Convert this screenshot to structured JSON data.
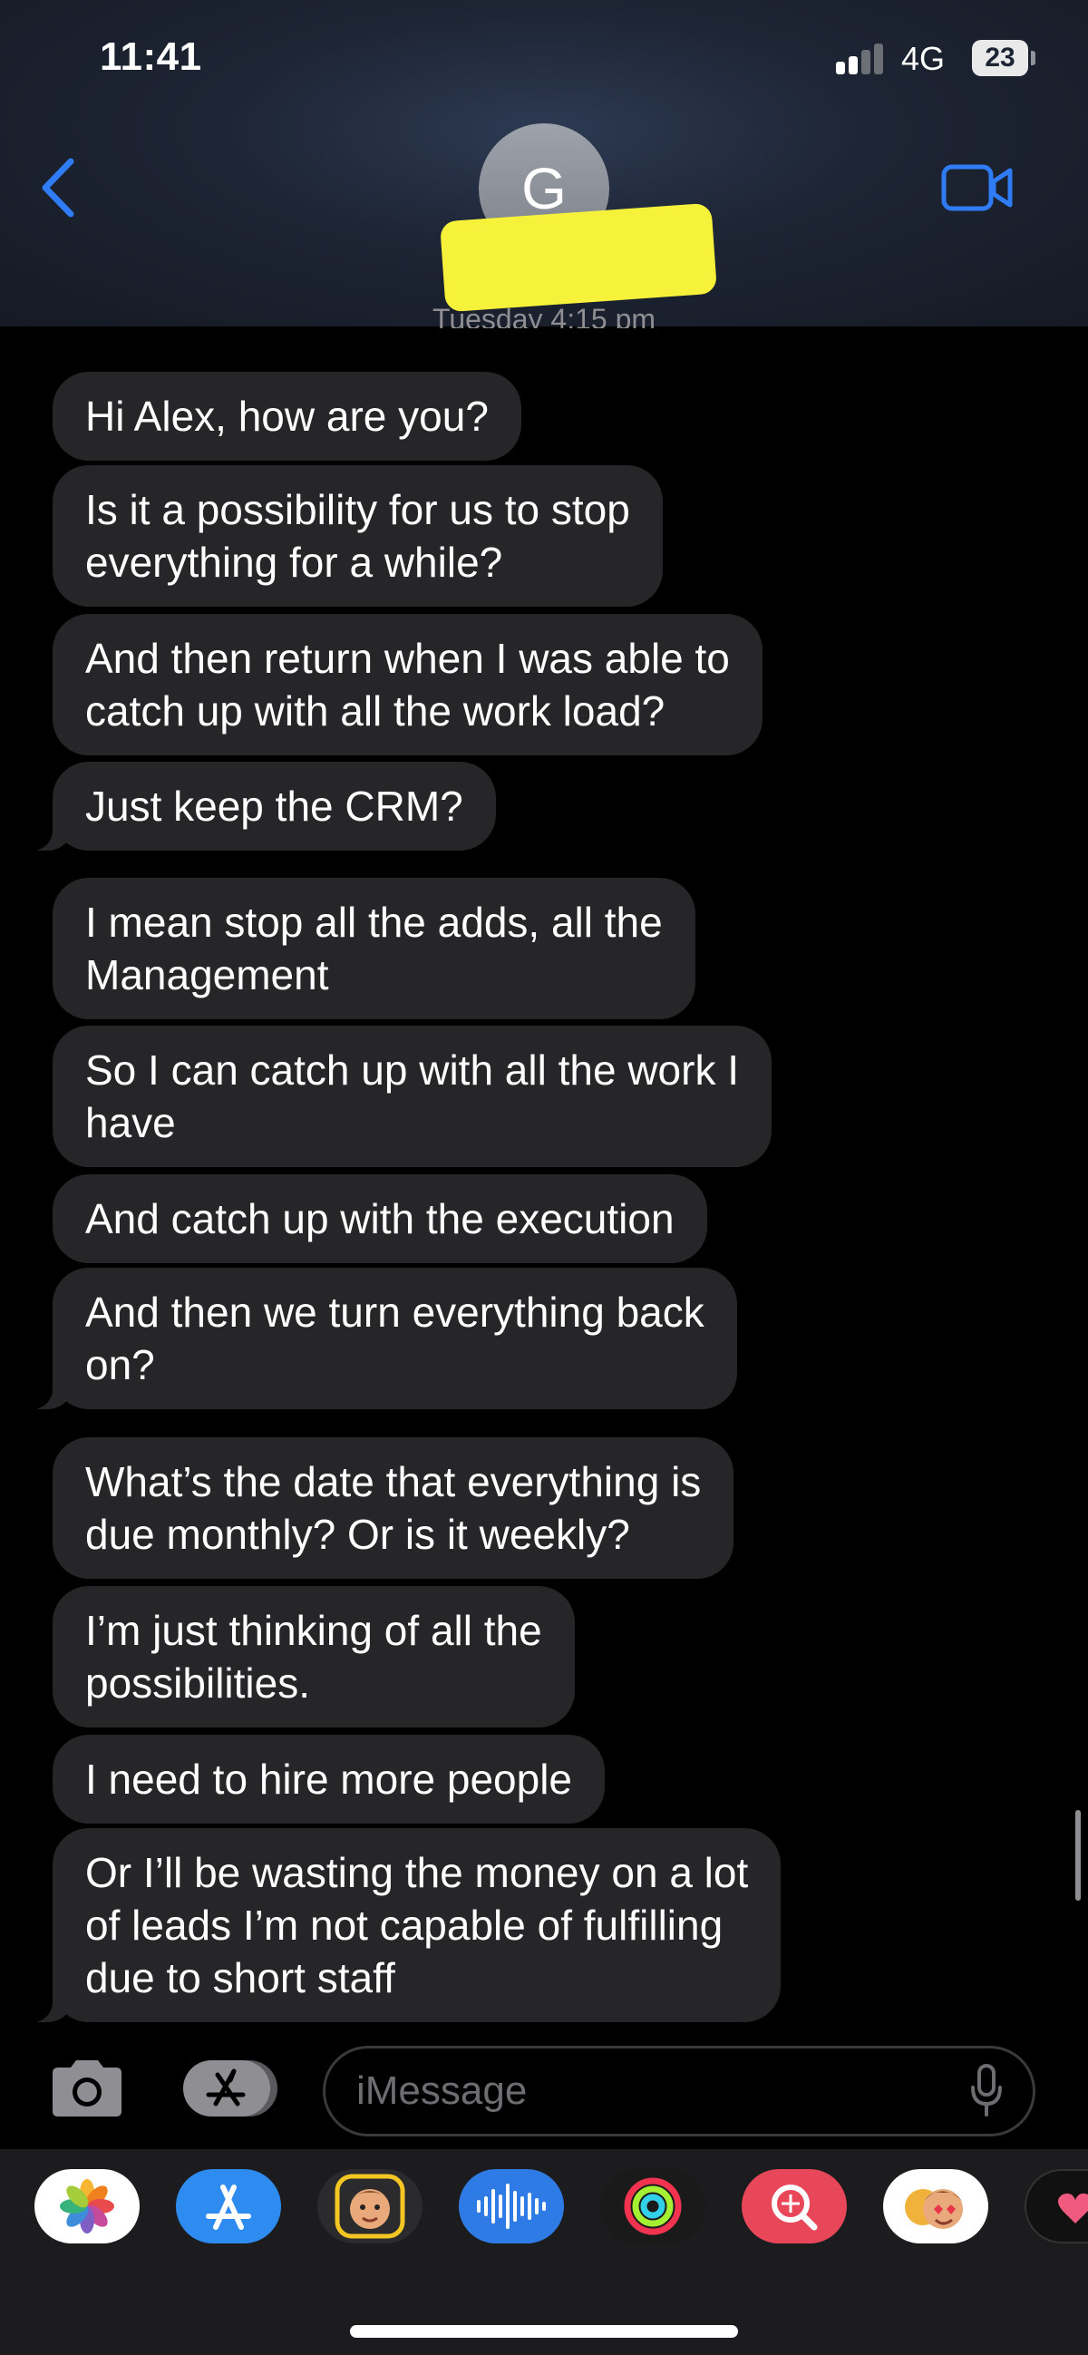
{
  "status_bar": {
    "time": "11:41",
    "network": "4G",
    "battery": "23"
  },
  "header": {
    "avatar_initial": "G",
    "date_label": "Tuesday 4:15 pm"
  },
  "messages": [
    {
      "lines": [
        "Hi Alex, how are you?"
      ]
    },
    {
      "lines": [
        "Is it a possibility for us to stop",
        "everything for a while?"
      ]
    },
    {
      "lines": [
        "And then return when I was able to",
        "catch up with all the work load?"
      ]
    },
    {
      "lines": [
        "Just keep the CRM?"
      ]
    },
    {
      "lines": [
        "I mean stop all the adds, all the",
        "Management"
      ]
    },
    {
      "lines": [
        "So I can catch up with all the work I",
        "have"
      ]
    },
    {
      "lines": [
        "And catch up with the execution"
      ]
    },
    {
      "lines": [
        "And then we turn everything back",
        "on?"
      ]
    },
    {
      "lines": [
        "What’s the date that everything is",
        "due monthly? Or is it weekly?"
      ]
    },
    {
      "lines": [
        "I’m just thinking of all the",
        "possibilities."
      ]
    },
    {
      "lines": [
        "I need to hire more people"
      ]
    },
    {
      "lines": [
        "Or I’ll be wasting the money on a lot",
        "of leads I’m not capable of fulfilling",
        "due to short staff"
      ]
    }
  ],
  "input": {
    "placeholder": "iMessage"
  },
  "app_drawer": [
    {
      "icon": "photos-icon",
      "color": "#ffffff"
    },
    {
      "icon": "app-store-icon",
      "color": "#2e8cf0"
    },
    {
      "icon": "memoji-icon",
      "color": "#2b2b2d"
    },
    {
      "icon": "audio-message-icon",
      "color": "#2f7be6"
    },
    {
      "icon": "activity-icon",
      "color": "#1a1a1a"
    },
    {
      "icon": "image-search-icon",
      "color": "#e8475a"
    },
    {
      "icon": "memoji-stickers-icon",
      "color": "#ffffff"
    },
    {
      "icon": "digital-touch-icon",
      "color": "#111111"
    }
  ]
}
